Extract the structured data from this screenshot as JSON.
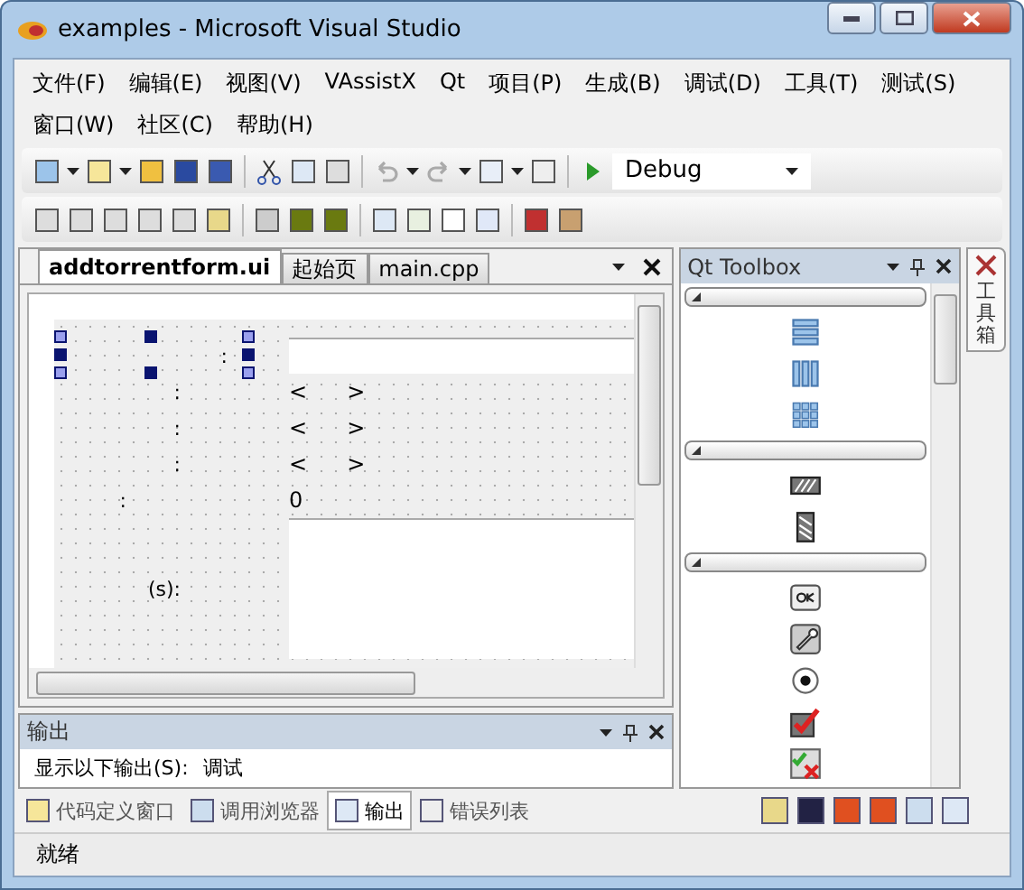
{
  "window": {
    "title": "examples - Microsoft Visual Studio"
  },
  "menu": [
    "文件(F)",
    "编辑(E)",
    "视图(V)",
    "VAssistX",
    "Qt",
    "项目(P)",
    "生成(B)",
    "调试(D)",
    "工具(T)",
    "测试(S)",
    "窗口(W)",
    "社区(C)",
    "帮助(H)"
  ],
  "toolbar": {
    "configuration": "Debug"
  },
  "doc_tabs": [
    {
      "label": "addtorrentform.ui",
      "selected": true
    },
    {
      "label": "起始页",
      "selected": false
    },
    {
      "label": "main.cpp",
      "selected": false
    }
  ],
  "form": {
    "rows": [
      {
        "kind": "field",
        "label": ":",
        "selected": true
      },
      {
        "kind": "spin",
        "label": ":",
        "less": "<",
        "more": ">"
      },
      {
        "kind": "spin",
        "label": ":",
        "less": "<",
        "more": ">"
      },
      {
        "kind": "spin",
        "label": ":",
        "less": "<",
        "more": ">"
      },
      {
        "kind": "value",
        "label": ":",
        "value": "0"
      },
      {
        "kind": "area",
        "label": "(s):"
      }
    ]
  },
  "toolbox": {
    "title": "Qt Toolbox",
    "groups": [
      {
        "expanded": true,
        "kind": "layouts"
      },
      {
        "expanded": true,
        "kind": "spacers"
      },
      {
        "expanded": true,
        "kind": "buttons"
      }
    ]
  },
  "side_tab": "工具箱",
  "output": {
    "title": "输出",
    "show_label": "显示以下输出(S):",
    "source": "调试"
  },
  "bottom_tabs": [
    {
      "label": "代码定义窗口",
      "selected": false
    },
    {
      "label": "调用浏览器",
      "selected": false
    },
    {
      "label": "输出",
      "selected": true
    },
    {
      "label": "错误列表",
      "selected": false
    }
  ],
  "status": "就绪"
}
